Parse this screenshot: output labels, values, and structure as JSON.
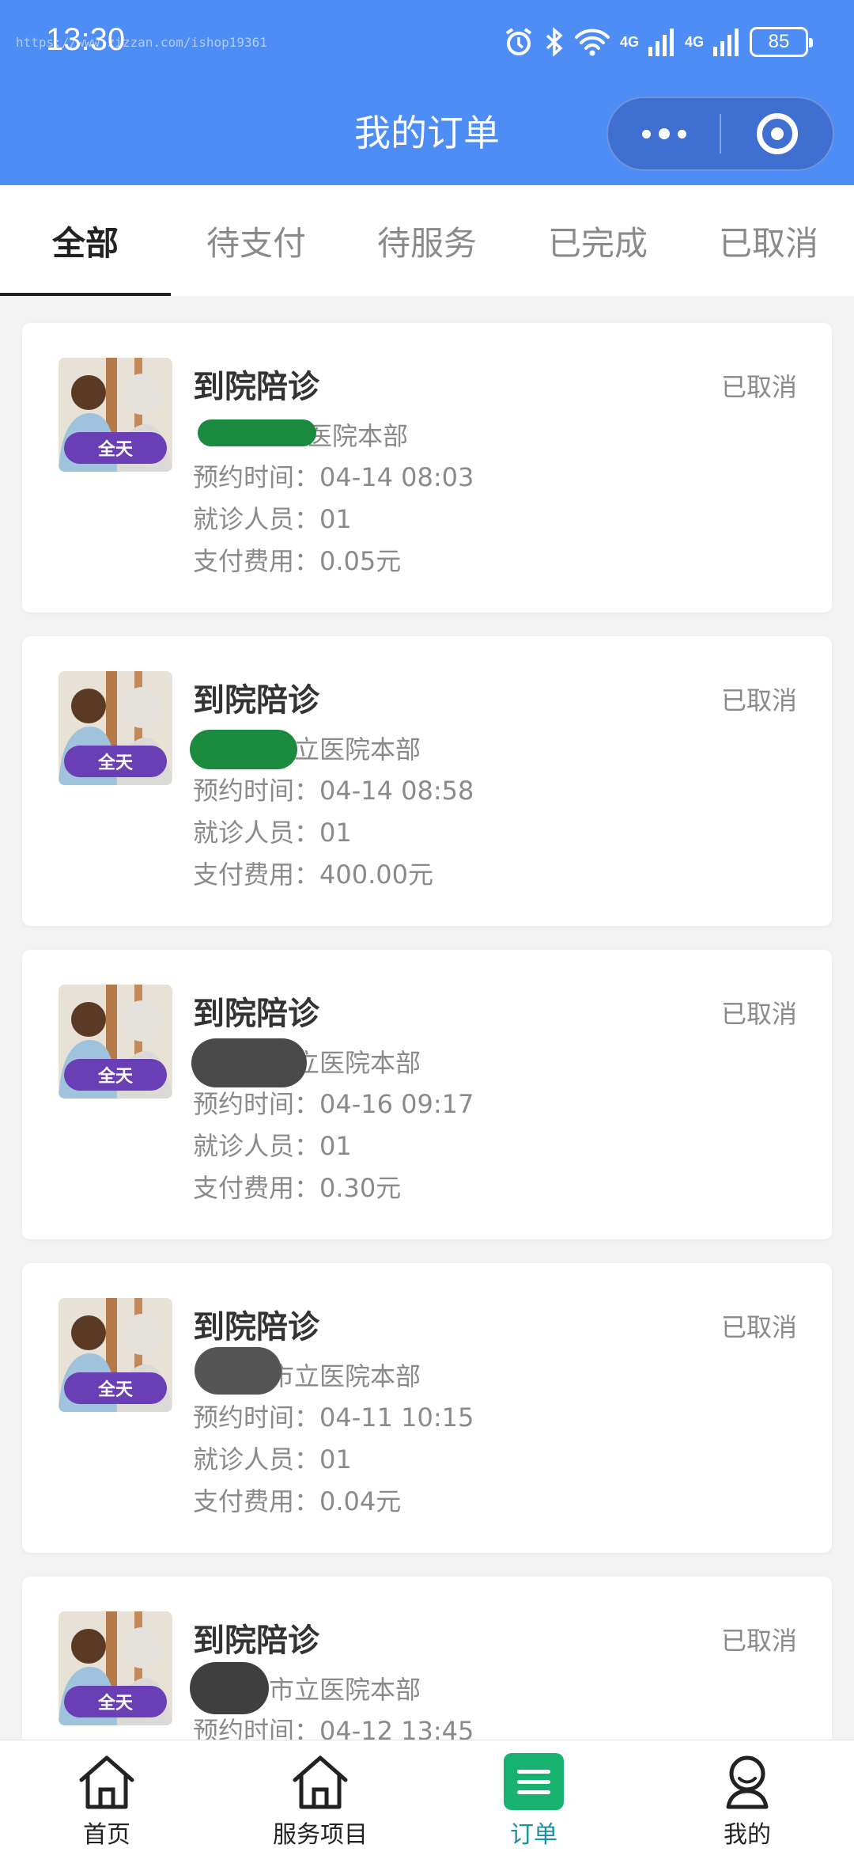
{
  "status_bar": {
    "time": "13:30",
    "watermark": "https://www.zizzan.com/ishop19361",
    "network_1": "4G",
    "network_2": "4G",
    "battery": "85"
  },
  "nav": {
    "title": "我的订单"
  },
  "tabs": [
    {
      "label": "全部",
      "active": true
    },
    {
      "label": "待支付",
      "active": false
    },
    {
      "label": "待服务",
      "active": false
    },
    {
      "label": "已完成",
      "active": false
    },
    {
      "label": "已取消",
      "active": false
    }
  ],
  "orders": [
    {
      "badge": "全天",
      "title": "到院陪诊",
      "status": "已取消",
      "hospital": "医院本部",
      "time_label": "预约时间：",
      "time_value": "04-14 08:03",
      "patient_label": "就诊人员：",
      "patient_value": "01",
      "fee_label": "支付费用：",
      "fee_value": "0.05元"
    },
    {
      "badge": "全天",
      "title": "到院陪诊",
      "status": "已取消",
      "hospital": "立医院本部",
      "time_label": "预约时间：",
      "time_value": "04-14 08:58",
      "patient_label": "就诊人员：",
      "patient_value": "01",
      "fee_label": "支付费用：",
      "fee_value": "400.00元"
    },
    {
      "badge": "全天",
      "title": "到院陪诊",
      "status": "已取消",
      "hospital": "市立医院本部",
      "time_label": "预约时间：",
      "time_value": "04-16 09:17",
      "patient_label": "就诊人员：",
      "patient_value": "01",
      "fee_label": "支付费用：",
      "fee_value": "0.30元"
    },
    {
      "badge": "全天",
      "title": "到院陪诊",
      "status": "已取消",
      "hospital": "市市立医院本部",
      "time_label": "预约时间：",
      "time_value": "04-11 10:15",
      "patient_label": "就诊人员：",
      "patient_value": "01",
      "fee_label": "支付费用：",
      "fee_value": "0.04元"
    },
    {
      "badge": "全天",
      "title": "到院陪诊",
      "status": "已取消",
      "hospital": "市市立医院本部",
      "time_label": "预约时间：",
      "time_value": "04-12 13:45"
    }
  ],
  "bottom_nav": [
    {
      "label": "首页",
      "icon": "home-icon"
    },
    {
      "label": "服务项目",
      "icon": "home-outline-icon"
    },
    {
      "label": "订单",
      "icon": "order-list-icon",
      "active": true
    },
    {
      "label": "我的",
      "icon": "user-icon"
    }
  ],
  "colors": {
    "header": "#4d8df5",
    "badge": "#6a3fb5",
    "order_icon": "#17b26f",
    "active_label": "#1a8fa0"
  }
}
